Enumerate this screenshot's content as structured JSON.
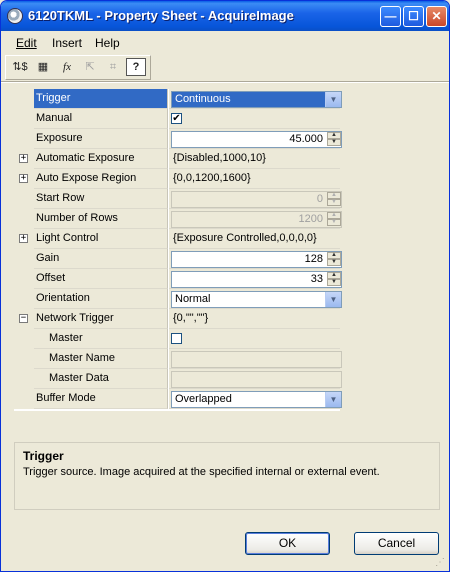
{
  "window": {
    "title": "6120TKML - Property Sheet - AcquireImage",
    "minimize_glyph": "—",
    "maximize_glyph": "☐",
    "close_glyph": "✕"
  },
  "menu": [
    {
      "label": "Edit"
    },
    {
      "label": "Insert"
    },
    {
      "label": "Help"
    }
  ],
  "toolbar": {
    "icons": [
      "sort-by-name-icon",
      "grid-icon",
      "function-icon",
      "cursor-icon",
      "select-region-icon",
      "help-icon"
    ],
    "glyphs": [
      "⇅$",
      "▦",
      "fx",
      "⇱",
      "⌗",
      "?"
    ]
  },
  "properties": [
    {
      "name": "Trigger",
      "value": "Continuous",
      "control": "combo",
      "selected": true
    },
    {
      "name": "Manual",
      "value": "✔",
      "control": "checkbox"
    },
    {
      "name": "Exposure",
      "value": "45.000",
      "control": "spin"
    },
    {
      "name": "Automatic Exposure",
      "value": "{Disabled,1000,10}",
      "control": "text",
      "expander": "+"
    },
    {
      "name": "Auto Expose Region",
      "value": "{0,0,1200,1600}",
      "control": "text",
      "expander": "+"
    },
    {
      "name": "Start Row",
      "value": "0",
      "control": "spin-disabled"
    },
    {
      "name": "Number of Rows",
      "value": "1200",
      "control": "spin-disabled"
    },
    {
      "name": "Light Control",
      "value": "{Exposure Controlled,0,0,0,0}",
      "control": "text",
      "expander": "+"
    },
    {
      "name": "Gain",
      "value": "128",
      "control": "spin"
    },
    {
      "name": "Offset",
      "value": "33",
      "control": "spin"
    },
    {
      "name": "Orientation",
      "value": "Normal",
      "control": "combo"
    },
    {
      "name": "Network Trigger",
      "value": "{0,\"\",\"\"}",
      "control": "text",
      "expander": "−"
    },
    {
      "name": "Master",
      "value": "",
      "control": "checkbox",
      "indent": true
    },
    {
      "name": "Master Name",
      "value": "",
      "control": "textbox-disabled",
      "indent": true
    },
    {
      "name": "Master Data",
      "value": "",
      "control": "textbox-disabled",
      "indent": true
    },
    {
      "name": "Buffer Mode",
      "value": "Overlapped",
      "control": "combo"
    }
  ],
  "description": {
    "title": "Trigger",
    "text": "Trigger source. Image acquired at the specified internal or external event."
  },
  "buttons": {
    "ok": "OK",
    "cancel": "Cancel"
  },
  "glyphs": {
    "combo_arrow": "▼",
    "spin_up": "▲",
    "spin_down": "▼"
  }
}
